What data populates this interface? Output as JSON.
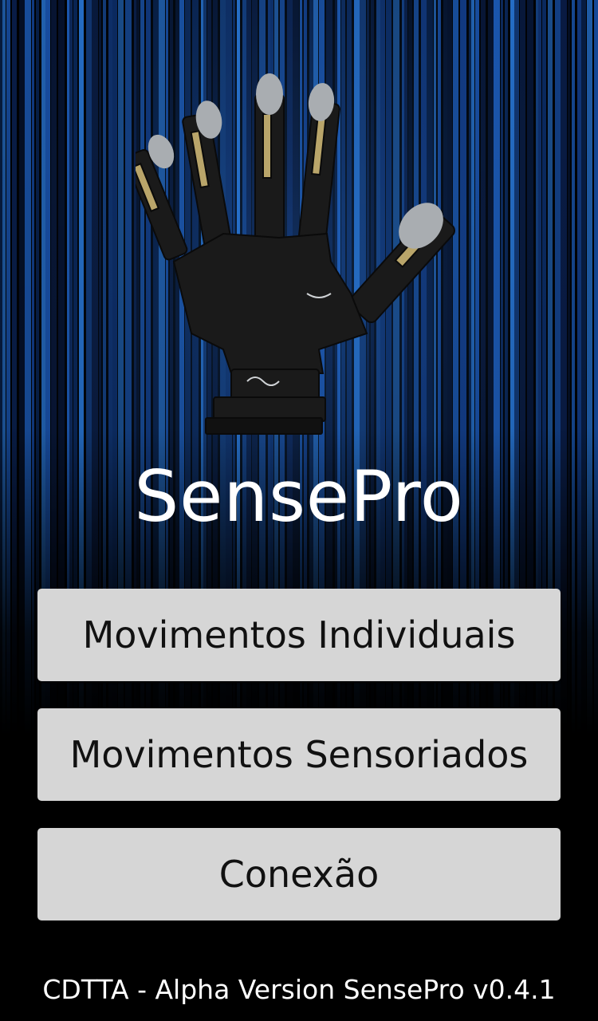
{
  "app": {
    "title": "SensePro",
    "hero_image": "robotic-hand"
  },
  "menu": {
    "buttons": [
      {
        "label": "Movimentos Individuais"
      },
      {
        "label": "Movimentos Sensoriados"
      },
      {
        "label": "Conexão"
      }
    ]
  },
  "footer": {
    "text": "CDTTA - Alpha Version SensePro v0.4.1"
  },
  "colors": {
    "background": "#000000",
    "curtain_blue": "#1e63c8",
    "button_bg": "#d6d6d6",
    "button_text": "#111111",
    "title_text": "#ffffff"
  }
}
